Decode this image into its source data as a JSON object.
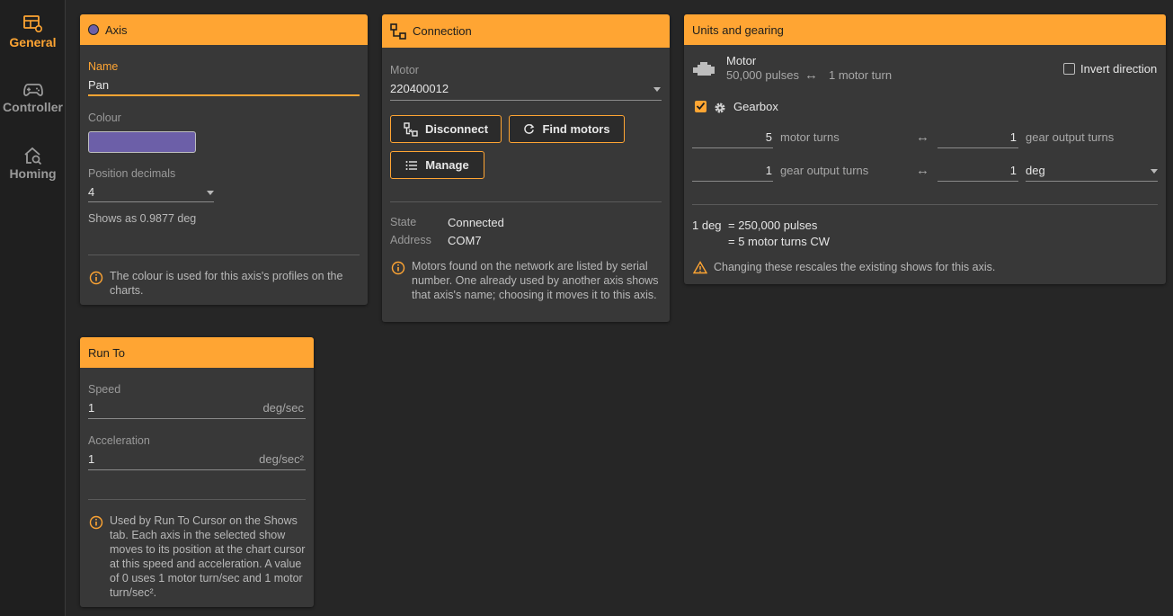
{
  "nav": {
    "general": "General",
    "controller": "Controller",
    "homing": "Homing"
  },
  "axis": {
    "title": "Axis",
    "name_label": "Name",
    "name_value": "Pan",
    "colour_label": "Colour",
    "colour_value": "#6c5fa8",
    "decimals_label": "Position decimals",
    "decimals_value": "4",
    "shows_as": "Shows as 0.9877 deg",
    "info": "The colour is used for this axis's profiles on the charts."
  },
  "connection": {
    "title": "Connection",
    "motor_label": "Motor",
    "motor_value": "220400012",
    "disconnect": "Disconnect",
    "find_motors": "Find motors",
    "manage": "Manage",
    "state_label": "State",
    "state_value": "Connected",
    "address_label": "Address",
    "address_value": "COM7",
    "info": "Motors found on the network are listed by serial number. One already used by another axis shows that axis's name; choosing it moves it to this axis."
  },
  "units": {
    "title": "Units and gearing",
    "motor_label": "Motor",
    "motor_pulses": "50,000 pulses",
    "arrow": "↔",
    "motor_turn": "1 motor turn",
    "invert_direction": "Invert direction",
    "gearbox_label": "Gearbox",
    "gearbox_checked": true,
    "row1_left_value": "5",
    "row1_left_unit": "motor turns",
    "row1_right_value": "1",
    "row1_right_unit": "gear output turns",
    "row2_left_value": "1",
    "row2_left_unit": "gear output turns",
    "row2_right_value": "1",
    "row2_unit_select": "deg",
    "summary_line1_a": "1 deg",
    "summary_line1_b": "= 250,000 pulses",
    "summary_line2": "= 5 motor turns CW",
    "warning": "Changing these rescales the existing shows for this axis."
  },
  "runto": {
    "title": "Run To",
    "speed_label": "Speed",
    "speed_value": "1",
    "speed_unit": "deg/sec",
    "accel_label": "Acceleration",
    "accel_value": "1",
    "accel_unit": "deg/sec²",
    "info": "Used by Run To Cursor on the Shows tab. Each axis in the selected show moves to its position at the chart cursor at this speed and acceleration. A value of 0 uses 1 motor turn/sec and 1 motor turn/sec²."
  },
  "colors": {
    "accent": "#ffa533",
    "axis_colour": "#6c5fa8"
  }
}
